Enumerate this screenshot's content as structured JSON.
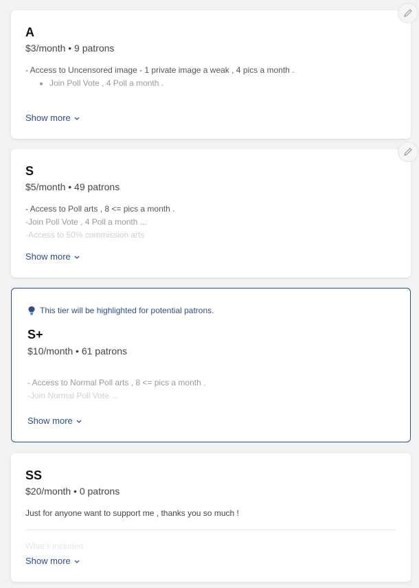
{
  "tiers": [
    {
      "name": "A",
      "price": "$3/month • 9 patrons",
      "line1": "- Access to Uncensored image - 1 private image a weak , 4 pics a month .",
      "bullet1": "Join Poll Vote , 4 Poll a month .",
      "show_more": "Show more"
    },
    {
      "name": "S",
      "price": "$5/month • 49 patrons",
      "line1": "- Access to Poll arts , 8 <= pics a month .",
      "line2": "-Join Poll Vote , 4 Poll a month ...",
      "line3": "-Access to 50% commission arts",
      "show_more": "Show more"
    },
    {
      "name": "S+",
      "highlight_note": "This tier will be highlighted for potential patrons.",
      "price": "$10/month • 61 patrons",
      "line1": "- Access to Normal Poll arts , 8 <= pics a month .",
      "line2": "-Join Normal Poll Vote ...",
      "show_more": "Show more"
    },
    {
      "name": "SS",
      "price": "$20/month • 0 patrons",
      "line1": "Just for anyone want to support me , thanks you so much !",
      "faded_heading": "What's included",
      "show_more": "Show more"
    }
  ],
  "colors": {
    "accent": "#2d4e88",
    "background": "#f2f2f4"
  },
  "icons": {
    "edit": "pencil-icon",
    "chevron": "chevron-down-icon",
    "tip": "lightbulb-icon"
  }
}
